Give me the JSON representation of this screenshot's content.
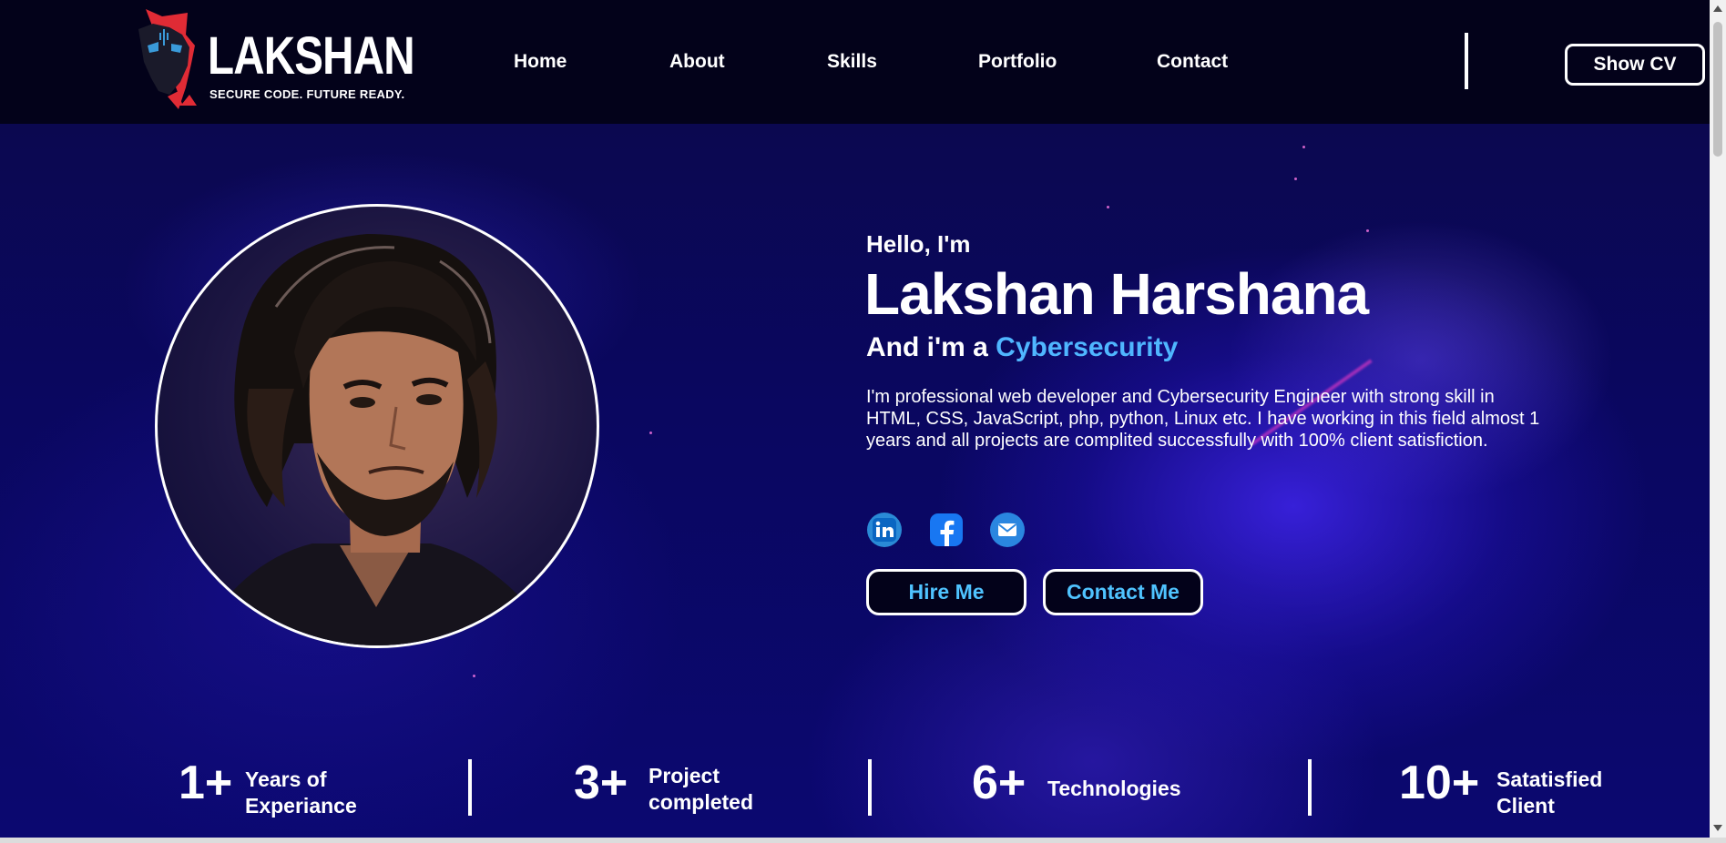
{
  "header": {
    "logo_title": "LAKSHAN",
    "logo_tagline": "SECURE CODE. FUTURE READY.",
    "nav": [
      "Home",
      "About",
      "Skills",
      "Portfolio",
      "Contact"
    ],
    "cv_button": "Show CV"
  },
  "hero": {
    "greeting": "Hello, I'm",
    "name": "Lakshan Harshana",
    "role_prefix": "And i'm a ",
    "role_highlight": "Cybersecurity",
    "bio": "I'm professional web developer and Cybersecurity Engineer with strong skill in HTML, CSS, JavaScript, php, python, Linux etc. I have working in this field almost 1 years and all projects are complited successfully with 100% client satisfiction.",
    "socials": [
      "linkedin-icon",
      "facebook-icon",
      "email-icon"
    ],
    "buttons": {
      "hire": "Hire Me",
      "contact": "Contact Me"
    }
  },
  "stats": [
    {
      "value": "1+",
      "label_line1": "Years of",
      "label_line2": "Experiance"
    },
    {
      "value": "3+",
      "label_line1": "Project",
      "label_line2": "completed"
    },
    {
      "value": "6+",
      "label_line1": "Technologies",
      "label_line2": ""
    },
    {
      "value": "10+",
      "label_line1": "Satatisfied",
      "label_line2": "Client"
    }
  ],
  "colors": {
    "accent": "#4fb6ff",
    "button_text": "#4fc3ff",
    "background": "#05031a",
    "logo_red": "#e02b35"
  }
}
